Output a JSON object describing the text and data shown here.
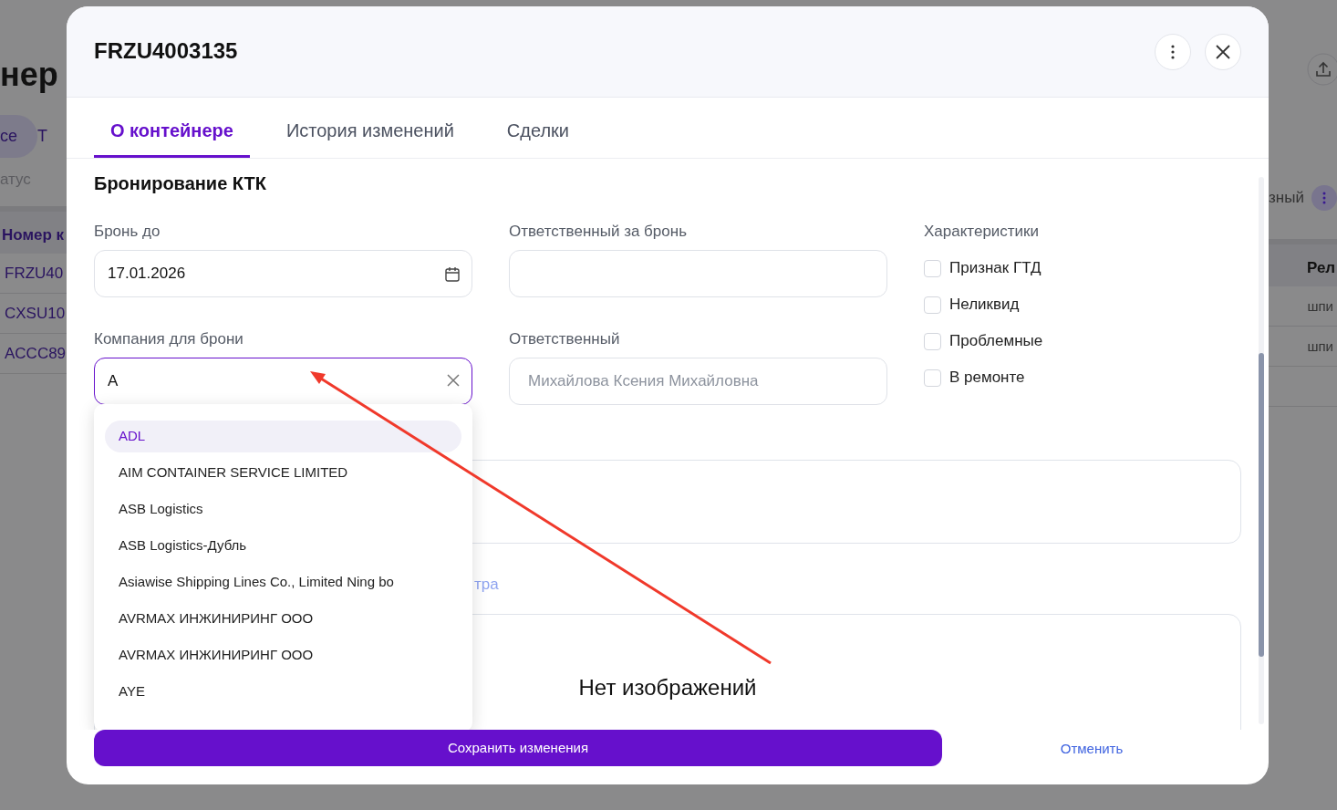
{
  "background_page": {
    "title": "нер",
    "filter_chips": [
      {
        "label": "се",
        "selected": true
      },
      {
        "label": "Т",
        "selected": false
      }
    ],
    "status_filter": {
      "placeholder": "атус"
    },
    "right_filter": {
      "value": "зный"
    },
    "table": {
      "columns": [
        "Номер к",
        "Рел"
      ],
      "rows": [
        {
          "column_1": "FRZU40",
          "column_2": "шпи"
        },
        {
          "column_1": "CXSU10",
          "column_2": "шпи"
        },
        {
          "column_1": "ACCC89"
        }
      ]
    }
  },
  "dialog": {
    "title": "FRZU4003135",
    "tabs": [
      {
        "label": "О контейнере",
        "selected": true
      },
      {
        "label": "История изменений",
        "selected": false
      },
      {
        "label": "Сделки",
        "selected": false
      }
    ],
    "section_title": "Бронирование КТК",
    "booking_until": {
      "label": "Бронь до",
      "value": "17.01.2026"
    },
    "booking_company": {
      "label": "Компания для брони",
      "value": "A",
      "focused": true
    },
    "booking_responsible": {
      "label": "Ответственный за бронь"
    },
    "responsible": {
      "label": "Ответственный",
      "value": "Михайлова Ксения Михайловна",
      "disabled": true
    },
    "characteristics": {
      "label": "Характеристики",
      "items": [
        {
          "label": "Признак ГТД",
          "checked": false
        },
        {
          "label": "Неликвид",
          "checked": false
        },
        {
          "label": "Проблемные",
          "checked": false
        },
        {
          "label": "В ремонте",
          "checked": false
        }
      ]
    },
    "company_options": [
      {
        "label": "ADL",
        "selected": true
      },
      {
        "label": "AIM CONTAINER SERVICE LIMITED",
        "selected": false
      },
      {
        "label": "ASB Logistics",
        "selected": false
      },
      {
        "label": "ASB Logistics-Дубль",
        "selected": false
      },
      {
        "label": "Asiawise Shipping Lines Co., Limited Ning bo",
        "selected": false
      },
      {
        "label": "AVRMAX ИНЖИНИРИНГ ООО",
        "selected": false
      },
      {
        "label": "AVRMAX ИНЖИНИРИНГ ООО",
        "selected": false
      },
      {
        "label": "AYE",
        "selected": false
      }
    ],
    "link_fragment": "тра",
    "images": {
      "empty_text": "Нет изображений"
    },
    "save_button": "Сохранить изменения",
    "cancel_button": "Отменить"
  }
}
